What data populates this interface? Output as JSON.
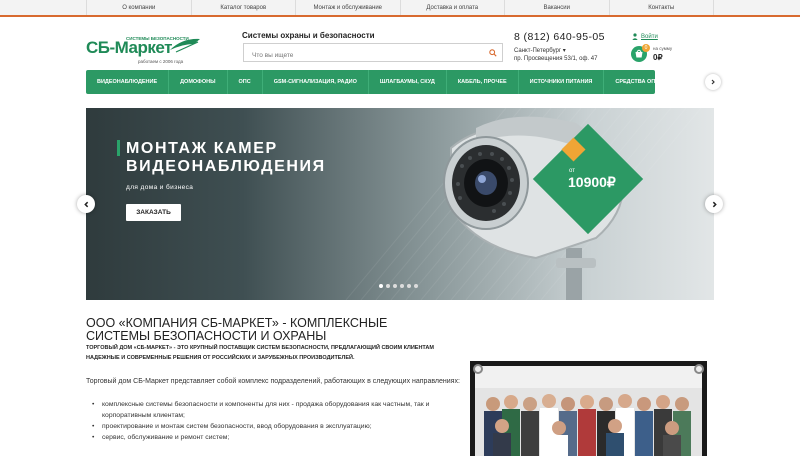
{
  "topnav": [
    "О компании",
    "Каталог товаров",
    "Монтаж и обслуживание",
    "Доставка и оплата",
    "Вакансии",
    "Контакты"
  ],
  "logo": {
    "name": "СБ-Маркет",
    "tagline": "СИСТЕМЫ БЕЗОПАСНОСТИ",
    "since": "работаем с 2006 года"
  },
  "header": {
    "tagline": "Системы охраны и безопасности",
    "search_placeholder": "Что вы ищете",
    "phone": "8 (812) 640-95-05",
    "city": "Санкт-Петербург",
    "address": "пр. Просвещения 53/1, оф. 47",
    "login": "Войти",
    "cart_label": "на сумму",
    "cart_sum": "0₽",
    "cart_count": "0"
  },
  "categories": [
    "ВИДЕОНАБЛЮДЕНИЕ",
    "ДОМОФОНЫ",
    "ОПС",
    "GSM-СИГНАЛИЗАЦИЯ, РАДИО",
    "ШЛАГБАУМЫ, СКУД",
    "КАБЕЛЬ, ПРОЧЕЕ",
    "ИСТОЧНИКИ ПИТАНИЯ",
    "СРЕДСТВА ОПОВЕЩЕНИЯ"
  ],
  "banner": {
    "title_line1": "МОНТАЖ КАМЕР",
    "title_line2": "ВИДЕОНАБЛЮДЕНИЯ",
    "subtitle": "для дома и бизнеса",
    "button": "ЗАКАЗАТЬ",
    "price_from": "от",
    "price": "10900₽",
    "slide_count": 6,
    "active_slide": 0
  },
  "content": {
    "heading": "ООО «КОМПАНИЯ СБ-МАРКЕТ» - КОМПЛЕКСНЫЕ СИСТЕМЫ БЕЗОПАСНОСТИ И ОХРАНЫ",
    "lead": "ТОРГОВЫЙ ДОМ «СБ-МАРКЕТ» - ЭТО КРУПНЫЙ ПОСТАВЩИК СИСТЕМ БЕЗОПАСНОСТИ, ПРЕДЛАГАЮЩИЙ СВОИМ КЛИЕНТАМ НАДЕЖНЫЕ И СОВРЕМЕННЫЕ РЕШЕНИЯ ОТ РОССИЙСКИХ И ЗАРУБЕЖНЫХ ПРОИЗВОДИТЕЛЕЙ.",
    "intro": "Торговый дом СБ-Маркет представляет собой комплекс подразделений, работающих в следующих направлениях:",
    "bullets": [
      "комплексные системы безопасности и компоненты для них - продажа оборудования как частным, так и корпоративным клиентам;",
      "проектирование и монтаж систем безопасности, ввод оборудования в эксплуатацию;",
      "сервис, обслуживание и ремонт систем;"
    ]
  },
  "colors": {
    "brand_green": "#2c9964",
    "accent_orange": "#f0a535",
    "topnav_border": "#d86a2f"
  }
}
